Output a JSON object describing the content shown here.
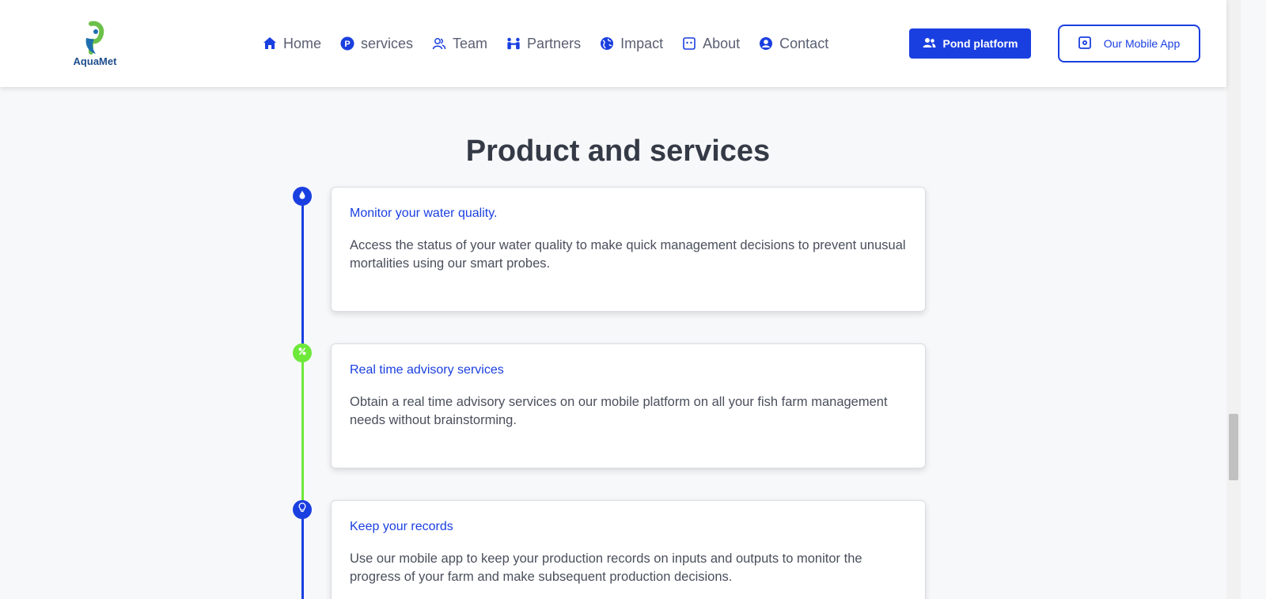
{
  "header": {
    "logo_text": "AquaMet",
    "nav": [
      {
        "label": "Home",
        "icon": "home-icon"
      },
      {
        "label": "services",
        "icon": "parking-circle-icon"
      },
      {
        "label": "Team",
        "icon": "users-outline-icon"
      },
      {
        "label": "Partners",
        "icon": "handshake-people-icon"
      },
      {
        "label": "Impact",
        "icon": "globe-icon"
      },
      {
        "label": "About",
        "icon": "info-square-icon"
      },
      {
        "label": "Contact",
        "icon": "user-circle-icon"
      }
    ],
    "pond_button": "Pond platform",
    "app_button": "Our Mobile App"
  },
  "main": {
    "title": "Product and services",
    "items": [
      {
        "title": "Monitor your water quality.",
        "body": "Access the status of your water quality to make quick management decisions to prevent unusual mortalities using our smart probes.",
        "icon": "water-drop-icon",
        "color": "#1a3fe0"
      },
      {
        "title": "Real time advisory services",
        "body": "Obtain a real time advisory services on our mobile platform on all your fish farm management needs without brainstorming.",
        "icon": "percent-icon",
        "color": "#6ee83a"
      },
      {
        "title": "Keep your records",
        "body": "Use our mobile app to keep your production records on inputs and outputs to monitor the progress of your farm and make subsequent production decisions.",
        "icon": "lightbulb-icon",
        "color": "#1a3fe0"
      }
    ]
  },
  "colors": {
    "primary": "#1a3fe0",
    "accent_green": "#6ee83a",
    "background": "#f7f8fa"
  }
}
